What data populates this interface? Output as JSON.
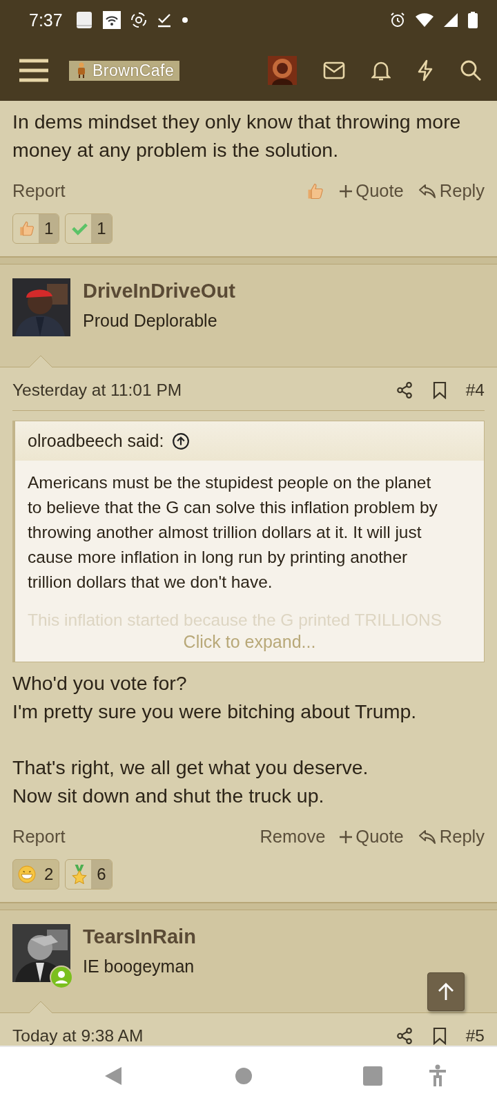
{
  "status_bar": {
    "time": "7:37"
  },
  "header": {
    "logo": "BrownCafe"
  },
  "posts": [
    {
      "body": [
        [
          "In dems mindset they only know that throwing more",
          "money at any problem is the solution."
        ]
      ],
      "actions": [
        {
          "kind": "report",
          "label": "Report"
        },
        {
          "kind": "react"
        },
        {
          "kind": "quote",
          "label": "Quote"
        },
        {
          "kind": "reply",
          "label": "Reply"
        }
      ],
      "reactions": [
        {
          "kind": "like",
          "count": "1",
          "selected": false
        },
        {
          "kind": "agree",
          "count": "1",
          "selected": false
        }
      ]
    },
    {
      "author": "DriveInDriveOut",
      "user_title": "Proud Deplorable",
      "online": false,
      "date": "Yesterday at 11:01 PM",
      "number": "#4",
      "quote": {
        "source": "olroadbeech said:",
        "lines": [
          "Americans must be the stupidest people on the planet",
          "to believe that the G can solve this inflation problem by",
          "throwing another almost trillion dollars at it. It will just",
          "cause more inflation in long run by printing another",
          "trillion dollars that we don't have."
        ],
        "faded": "This inflation started because the G printed TRILLIONS",
        "expand": "Click to expand..."
      },
      "body": [
        [
          "Who'd you vote for?",
          "I'm pretty sure you were bitching about Trump."
        ],
        [
          "That's right, we all get what you deserve.",
          "Now sit down and shut the truck up."
        ]
      ],
      "actions": [
        {
          "kind": "report",
          "label": "Report"
        },
        {
          "kind": "remove",
          "label": "Remove"
        },
        {
          "kind": "quote",
          "label": "Quote"
        },
        {
          "kind": "reply",
          "label": "Reply"
        }
      ],
      "reactions": [
        {
          "kind": "haha",
          "count": "2",
          "selected": true
        },
        {
          "kind": "winner",
          "count": "6",
          "selected": false
        }
      ]
    },
    {
      "author": "TearsInRain",
      "user_title": "IE boogeyman",
      "online": true,
      "date": "Today at 9:38 AM",
      "number": "#5"
    }
  ]
}
